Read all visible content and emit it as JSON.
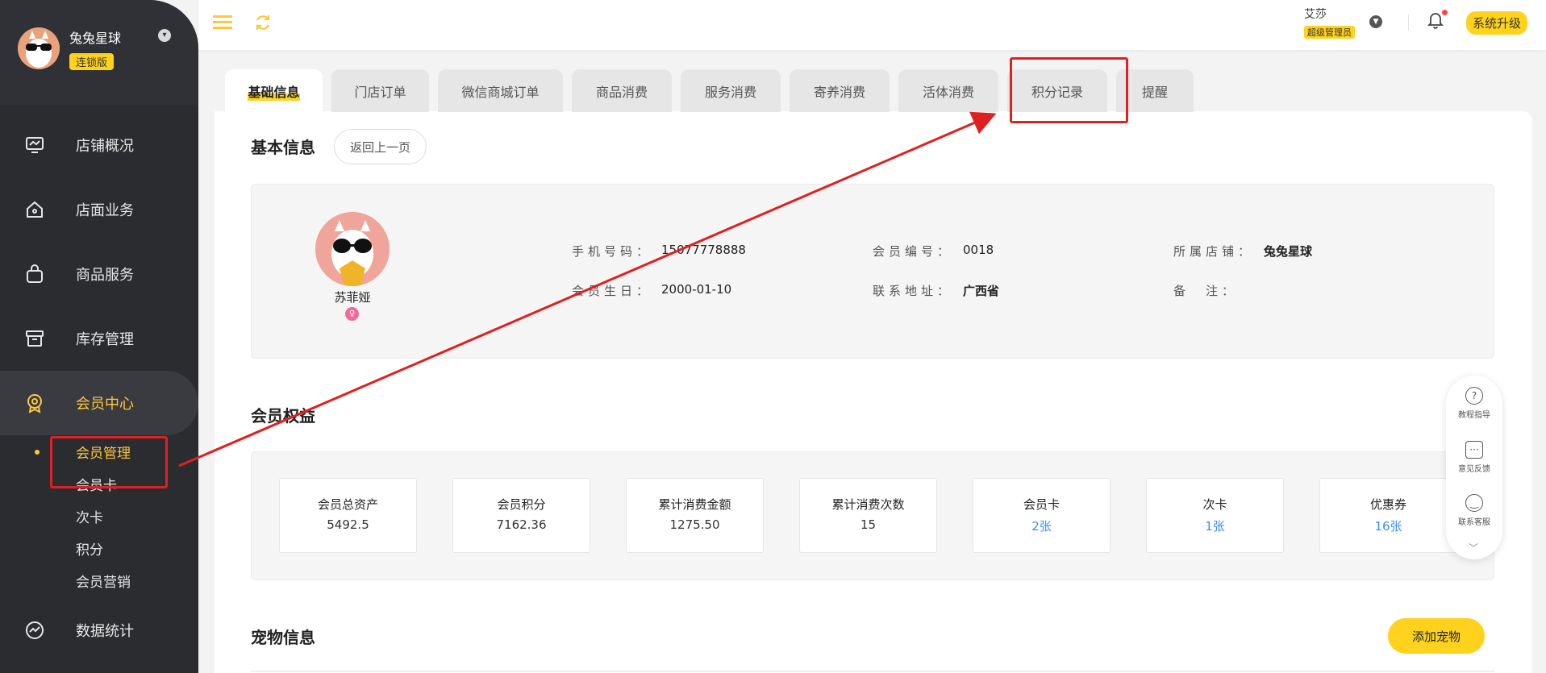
{
  "sidebar": {
    "brand_name": "兔兔星球",
    "brand_badge": "连锁版",
    "menu": [
      {
        "label": "店铺概况",
        "icon": "monitor-icon"
      },
      {
        "label": "店面业务",
        "icon": "home-icon"
      },
      {
        "label": "商品服务",
        "icon": "shopping-bag-icon"
      },
      {
        "label": "库存管理",
        "icon": "archive-box-icon"
      },
      {
        "label": "会员中心",
        "icon": "member-badge-icon"
      }
    ],
    "submenu": [
      "会员管理",
      "会员卡",
      "次卡",
      "积分",
      "会员营销"
    ],
    "bottom_menu": {
      "label": "数据统计",
      "icon": "chart-icon"
    }
  },
  "topbar": {
    "user_name": "艾莎",
    "user_role": "超级管理员",
    "upgrade_label": "系统升级"
  },
  "tabs": [
    "基础信息",
    "门店订单",
    "微信商城订单",
    "商品消费",
    "服务消费",
    "寄养消费",
    "活体消费",
    "积分记录",
    "提醒"
  ],
  "basic_info": {
    "title": "基本信息",
    "back_label": "返回上一页",
    "member_name": "苏菲娅",
    "fields": {
      "phone_label": "手机号码：",
      "phone_value": "15077778888",
      "member_no_label": "会员编号：",
      "member_no_value": "0018",
      "store_label": "所属店铺：",
      "store_value": "兔兔星球",
      "birthday_label": "会员生日：",
      "birthday_value": "2000-01-10",
      "address_label": "联系地址：",
      "address_value": "广西省",
      "note_label": "备　注："
    }
  },
  "benefits": {
    "title": "会员权益",
    "items": [
      {
        "label": "会员总资产",
        "value": "5492.5"
      },
      {
        "label": "会员积分",
        "value": "7162.36"
      },
      {
        "label": "累计消费金额",
        "value": "1275.50"
      },
      {
        "label": "累计消费次数",
        "value": "15"
      },
      {
        "label": "会员卡",
        "value": "2张"
      },
      {
        "label": "次卡",
        "value": "1张"
      },
      {
        "label": "优惠券",
        "value": "16张"
      }
    ]
  },
  "pets": {
    "title": "宠物信息",
    "add_label": "添加宠物"
  },
  "help_widget": {
    "items": [
      "教程指导",
      "意见反馈",
      "联系客服"
    ]
  },
  "colors": {
    "accent": "#ffd21e",
    "sidebar_bg": "#2b2c30",
    "active_menu": "#ffc83c",
    "annotation": "#e02020",
    "link": "#3d8ef0"
  }
}
